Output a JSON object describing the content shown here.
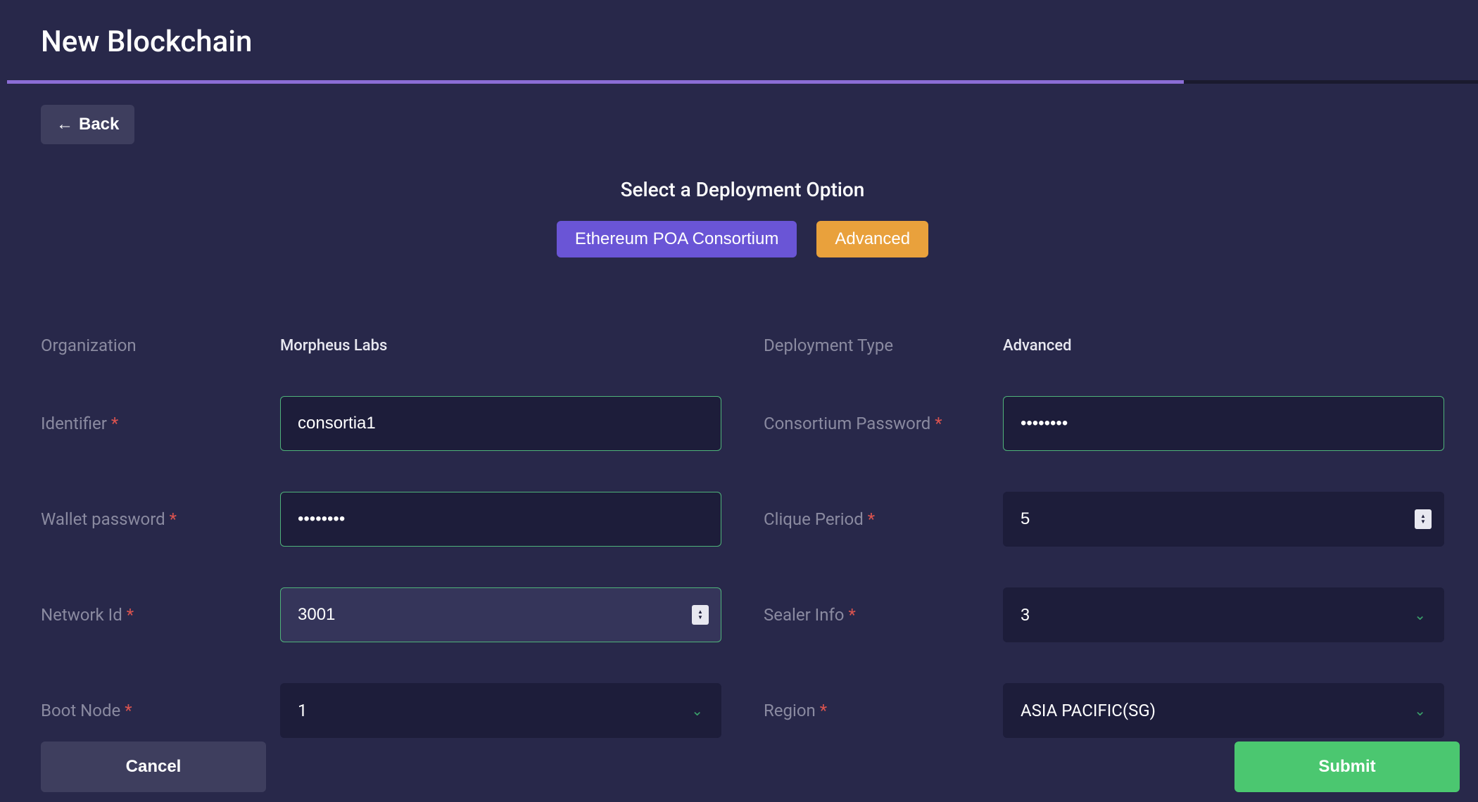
{
  "header": {
    "title": "New Blockchain",
    "back_label": "Back"
  },
  "deploy": {
    "heading": "Select a Deployment Option",
    "tab1": "Ethereum POA Consortium",
    "tab2": "Advanced"
  },
  "left": {
    "organization_label": "Organization",
    "organization_value": "Morpheus Labs",
    "identifier_label": "Identifier",
    "identifier_value": "consortia1",
    "wallet_pw_label": "Wallet password",
    "wallet_pw_value": "••••••••",
    "network_id_label": "Network Id",
    "network_id_value": "3001",
    "boot_node_label": "Boot Node",
    "boot_node_value": "1"
  },
  "right": {
    "deployment_type_label": "Deployment Type",
    "deployment_type_value": "Advanced",
    "consortium_pw_label": "Consortium Password",
    "consortium_pw_value": "••••••••",
    "clique_period_label": "Clique Period",
    "clique_period_value": "5",
    "sealer_info_label": "Sealer Info",
    "sealer_info_value": "3",
    "region_label": "Region",
    "region_value": "ASIA PACIFIC(SG)"
  },
  "footer": {
    "cancel": "Cancel",
    "submit": "Submit"
  }
}
